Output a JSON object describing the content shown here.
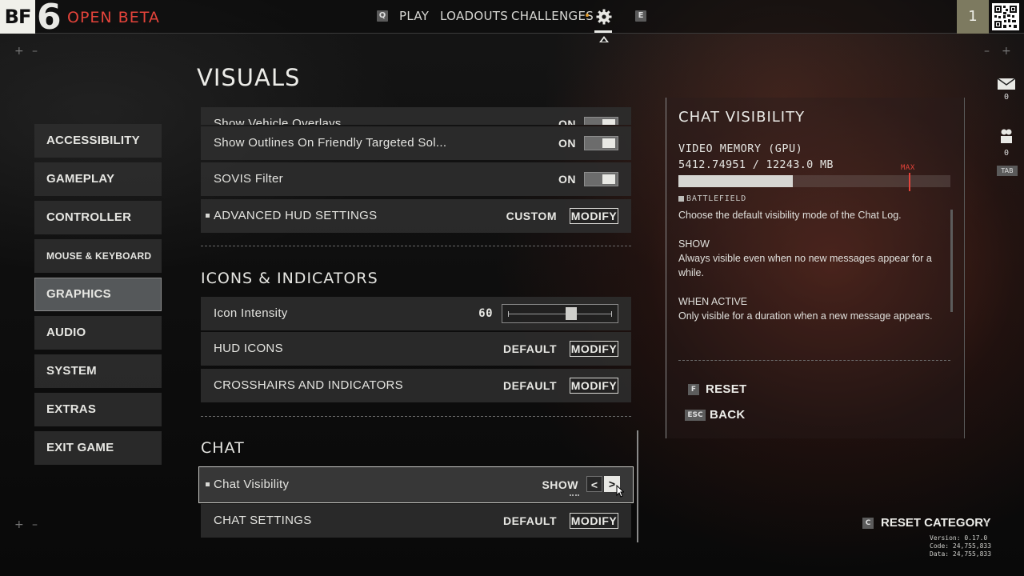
{
  "header": {
    "logo_text": "BF",
    "logo_number": "6",
    "beta_label": "OPEN BETA",
    "key_left": "Q",
    "key_right": "E",
    "nav": [
      "PLAY",
      "LOADOUTS",
      "CHALLENGES"
    ],
    "player_level": "1"
  },
  "corner_marks": {
    "plus": "+",
    "minus": "–"
  },
  "page_title": "VISUALS",
  "sidebar": {
    "items": [
      {
        "label": "ACCESSIBILITY",
        "active": false
      },
      {
        "label": "GAMEPLAY",
        "active": false
      },
      {
        "label": "CONTROLLER",
        "active": false
      },
      {
        "label": "MOUSE & KEYBOARD",
        "active": false
      },
      {
        "label": "GRAPHICS",
        "active": true
      },
      {
        "label": "AUDIO",
        "active": false
      },
      {
        "label": "SYSTEM",
        "active": false
      },
      {
        "label": "EXTRAS",
        "active": false
      },
      {
        "label": "EXIT GAME",
        "active": false
      }
    ]
  },
  "settings": {
    "vehicle_overlays": {
      "label": "Show Vehicle Overlays",
      "value": "ON"
    },
    "outlines": {
      "label": "Show Outlines On Friendly Targeted Sol...",
      "value": "ON"
    },
    "sovis": {
      "label": "SOVIS Filter",
      "value": "ON"
    },
    "advanced_hud": {
      "label": "ADVANCED HUD SETTINGS",
      "value": "CUSTOM",
      "button": "MODIFY"
    },
    "icons_section": "ICONS & INDICATORS",
    "icon_intensity": {
      "label": "Icon Intensity",
      "value": "60",
      "slider_fraction": 0.6
    },
    "hud_icons": {
      "label": "HUD ICONS",
      "value": "DEFAULT",
      "button": "MODIFY"
    },
    "crosshairs": {
      "label": "CROSSHAIRS AND INDICATORS",
      "value": "DEFAULT",
      "button": "MODIFY"
    },
    "chat_section": "CHAT",
    "chat_visibility": {
      "label": "Chat Visibility",
      "value": "SHOW",
      "prev": "<",
      "next": ">"
    },
    "chat_settings": {
      "label": "CHAT SETTINGS",
      "value": "DEFAULT",
      "button": "MODIFY"
    }
  },
  "info_panel": {
    "title": "CHAT VISIBILITY",
    "memory_label": "VIDEO MEMORY (GPU)",
    "memory_value": "5412.74951 / 12243.0 MB",
    "memory_fraction": 0.42,
    "max_label": "MAX",
    "brand": "BATTLEFIELD",
    "description": "Choose the default visibility mode of the Chat Log.",
    "show_heading": "SHOW",
    "show_text": "Always visible even when no new messages appear for a while.",
    "active_heading": "WHEN ACTIVE",
    "active_text": "Only visible for a duration when a new message appears.",
    "reset_key": "F",
    "reset_label": "RESET",
    "back_key": "ESC",
    "back_label": "BACK"
  },
  "rail": {
    "mail_count": "0",
    "squad_count": "0",
    "tab_key": "TAB"
  },
  "footer": {
    "reset_key": "C",
    "reset_category": "RESET CATEGORY",
    "dash": "–",
    "version": "Version: 0.17.0",
    "code": "Code: 24,755,833",
    "date": "Data: 24,755,833"
  },
  "colors": {
    "accent_red": "#e4433a",
    "notify_orange": "#e09a2a",
    "panel": "#2d2d2d"
  },
  "icons": {
    "settings": "gear-icon",
    "mail": "mail-icon",
    "squad": "squad-icon",
    "player": "player-avatar",
    "qr": "qr-code-icon"
  }
}
